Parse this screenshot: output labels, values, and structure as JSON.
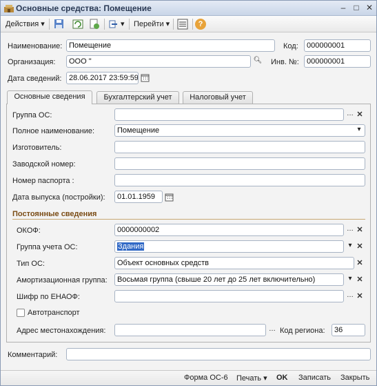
{
  "window": {
    "title": "Основные средства: Помещение"
  },
  "toolbar": {
    "actions_label": "Действия",
    "goto_label": "Перейти",
    "help_symbol": "?"
  },
  "header": {
    "name_label": "Наименование:",
    "name_value": "Помещение",
    "code_label": "Код:",
    "code_value": "000000001",
    "org_label": "Организация:",
    "org_value": "ООО \"",
    "inv_label": "Инв. №:",
    "inv_value": "000000001",
    "date_label": "Дата сведений:",
    "date_value": "28.06.2017 23:59:59"
  },
  "tabs": [
    {
      "label": "Основные сведения"
    },
    {
      "label": "Бухгалтерский учет"
    },
    {
      "label": "Налоговый учет"
    }
  ],
  "main": {
    "group_label": "Группа ОС:",
    "group_value": "",
    "fullname_label": "Полное наименование:",
    "fullname_value": "Помещение",
    "maker_label": "Изготовитель:",
    "maker_value": "",
    "serial_label": "Заводской номер:",
    "serial_value": "",
    "passport_label": "Номер паспорта :",
    "passport_value": "",
    "release_label": "Дата выпуска (постройки):",
    "release_value": "01.01.1959",
    "section_title": "Постоянные сведения",
    "okof_label": "ОКОФ:",
    "okof_value": "0000000002",
    "account_group_label": "Группа учета ОС:",
    "account_group_value": "Здания",
    "type_label": "Тип ОС:",
    "type_value": "Объект основных средств",
    "amort_label": "Амортизационная группа:",
    "amort_value": "Восьмая группа (свыше 20 лет до 25 лет включительно)",
    "enaof_label": "Шифр по ЕНАОФ:",
    "enaof_value": "",
    "auto_label": "Автотранспорт",
    "address_label": "Адрес местонахождения:",
    "address_value": "",
    "region_label": "Код региона:",
    "region_value": "36"
  },
  "comment": {
    "label": "Комментарий:",
    "value": ""
  },
  "statusbar": {
    "form_label": "Форма ОС-6",
    "print_label": "Печать",
    "ok_label": "OK",
    "save_label": "Записать",
    "close_label": "Закрыть"
  },
  "colors": {
    "accent": "#3169c6",
    "section": "#7a4b14"
  }
}
